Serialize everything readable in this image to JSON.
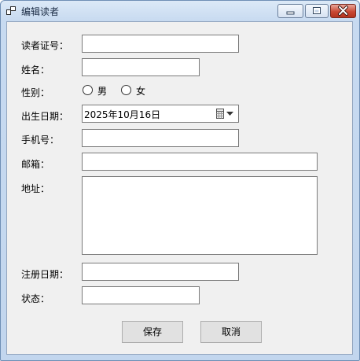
{
  "window": {
    "title": "编辑读者",
    "icons": {
      "app": "app-icon",
      "minimize": "minimize-icon",
      "maximize": "maximize-icon",
      "close": "close-icon"
    }
  },
  "form": {
    "reader_id": {
      "label": "读者证号：",
      "value": ""
    },
    "name": {
      "label": "姓名：",
      "value": ""
    },
    "gender": {
      "label": "性别：",
      "options": [
        {
          "label": "男",
          "checked": false
        },
        {
          "label": "女",
          "checked": false
        }
      ]
    },
    "birth_date": {
      "label": "出生日期：",
      "value": "2025年10月16日",
      "icons": [
        "calendar-icon",
        "dropdown-arrow-icon"
      ]
    },
    "phone": {
      "label": "手机号：",
      "value": ""
    },
    "email": {
      "label": "邮箱：",
      "value": ""
    },
    "address": {
      "label": "地址：",
      "value": ""
    },
    "register_date": {
      "label": "注册日期：",
      "value": ""
    },
    "status": {
      "label": "状态：",
      "value": ""
    }
  },
  "actions": {
    "save_label": "保存",
    "cancel_label": "取消"
  }
}
